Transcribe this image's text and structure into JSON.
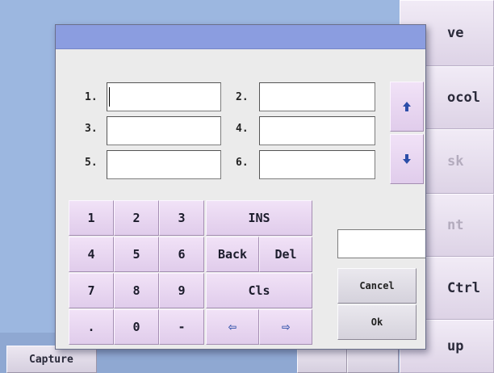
{
  "background": {
    "side_buttons": [
      "ve",
      "ocol",
      "sk",
      "nt",
      "Ctrl",
      "up"
    ],
    "bottom_buttons": [
      "Capture",
      "",
      ""
    ]
  },
  "dialog": {
    "field_labels": [
      "1.",
      "2.",
      "3.",
      "4.",
      "5.",
      "6."
    ],
    "field_values": [
      "",
      "",
      "",
      "",
      "",
      ""
    ],
    "scroll_up_icon": "arrow-up",
    "scroll_down_icon": "arrow-down",
    "keypad": {
      "k1": "1",
      "k2": "2",
      "k3": "3",
      "ins": "INS",
      "k4": "4",
      "k5": "5",
      "k6": "6",
      "back": "Back",
      "del": "Del",
      "k7": "7",
      "k8": "8",
      "k9": "9",
      "cls": "Cls",
      "dot": ".",
      "k0": "0",
      "minus": "-",
      "left": "⇦",
      "right": "⇨"
    },
    "display_value": "",
    "cancel_label": "Cancel",
    "ok_label": "Ok"
  },
  "colors": {
    "app_background": "#9cb7e0",
    "titlebar": "#8b9de0",
    "key_face": "#ead8f2",
    "arrow": "#2c4ea8"
  }
}
